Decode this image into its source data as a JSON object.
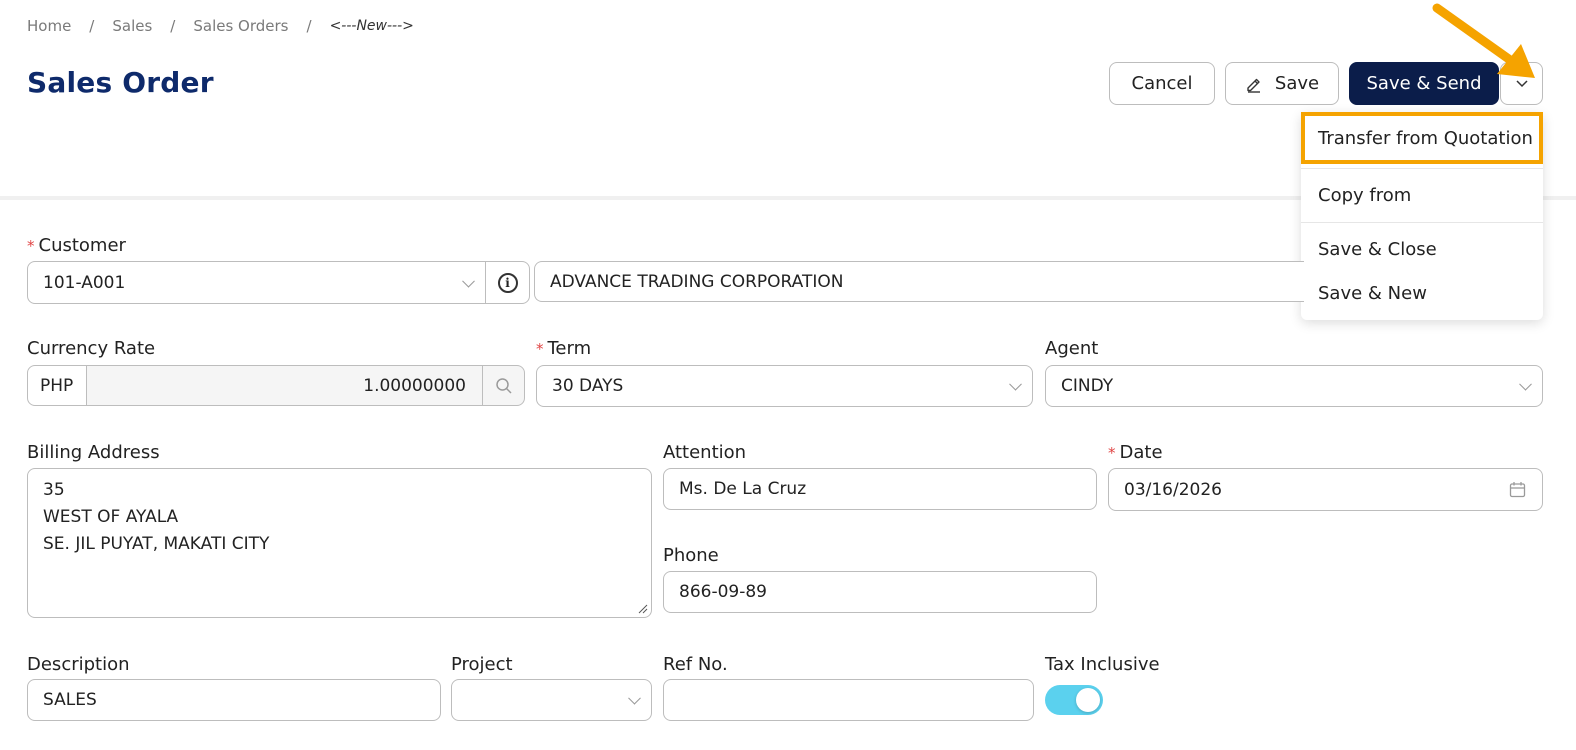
{
  "breadcrumb": {
    "items": [
      "Home",
      "Sales",
      "Sales Orders"
    ],
    "separator": "/",
    "current": "<---New--->"
  },
  "page": {
    "title": "Sales Order"
  },
  "toolbar": {
    "cancel_label": "Cancel",
    "save_label": "Save",
    "save_send_label": "Save & Send",
    "more_icon": "chevron-down-icon"
  },
  "dropdown_menu": {
    "items": [
      {
        "label": "Transfer from Quotation",
        "highlighted": true
      },
      {
        "label": "Copy from"
      },
      {
        "label": "Save & Close"
      },
      {
        "label": "Save & New"
      }
    ]
  },
  "form": {
    "customer": {
      "label": "Customer",
      "required": true,
      "code": "101-A001",
      "name": "ADVANCE TRADING CORPORATION"
    },
    "currency_rate": {
      "label": "Currency Rate",
      "currency": "PHP",
      "value": "1.00000000"
    },
    "term": {
      "label": "Term",
      "required": true,
      "value": "30 DAYS"
    },
    "agent": {
      "label": "Agent",
      "value": "CINDY"
    },
    "billing_address": {
      "label": "Billing Address",
      "lines": [
        "35",
        "WEST OF AYALA",
        "SE. JIL PUYAT, MAKATI CITY"
      ]
    },
    "attention": {
      "label": "Attention",
      "value": "Ms. De La Cruz"
    },
    "date": {
      "label": "Date",
      "required": true,
      "value": "03/16/2026"
    },
    "phone": {
      "label": "Phone",
      "value": "866-09-89"
    },
    "description": {
      "label": "Description",
      "value": "SALES"
    },
    "project": {
      "label": "Project",
      "value": ""
    },
    "ref_no": {
      "label": "Ref No.",
      "value": ""
    },
    "tax_inclusive": {
      "label": "Tax Inclusive",
      "enabled": true
    }
  },
  "colors": {
    "title": "#0e2a6b",
    "primary_button": "#0b1d4a",
    "highlight": "#f5a300",
    "toggle_on": "#5bd1ee",
    "required_mark": "#e04545"
  }
}
